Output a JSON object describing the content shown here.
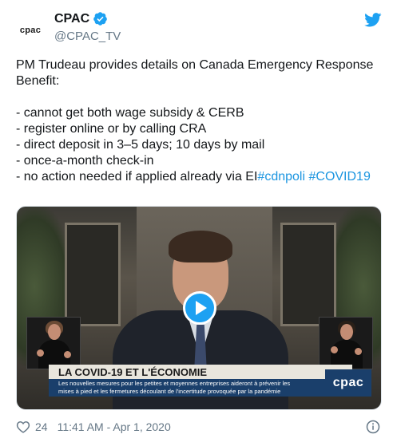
{
  "account": {
    "avatar_text": "cpac",
    "display_name": "CPAC",
    "handle": "@CPAC_TV",
    "verified": true
  },
  "tweet": {
    "lines": [
      "PM Trudeau provides details on Canada Emergency Response",
      "Benefit:",
      "",
      "- cannot get both wage subsidy & CERB",
      "- register online or by calling CRA",
      "- direct deposit in 3–5 days; 10 days by mail",
      "- once-a-month check-in"
    ],
    "last_line_text": "- no action needed if applied already via EI",
    "hashtags": [
      "#cdnpoli",
      "#COVID19"
    ]
  },
  "media": {
    "lower_third_title": "LA COVID-19 ET L'ÉCONOMIE",
    "lower_third_sub_1": "Les nouvelles mesures pour les petites et moyennes entreprises aideront à prévenir les",
    "lower_third_sub_2": "mises à pied et les fermetures découlant de l'incertitude provoquée par la pandémie",
    "channel_logo": "cpac"
  },
  "footer": {
    "likes": "24",
    "timestamp": "11:41 AM - Apr 1, 2020"
  },
  "colors": {
    "link": "#1b95e0",
    "twitter_blue": "#1da1f2",
    "muted": "#657786"
  },
  "icons": [
    "verified-icon",
    "twitter-bird-icon",
    "play-icon",
    "heart-icon",
    "info-icon"
  ]
}
